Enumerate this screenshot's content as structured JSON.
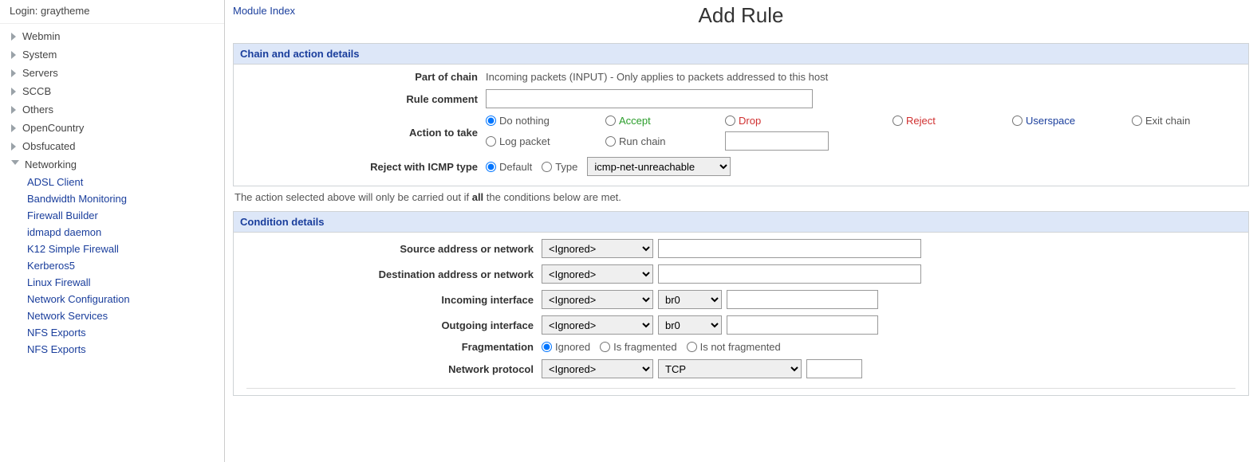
{
  "login": {
    "prefix": "Login:",
    "user": "graytheme"
  },
  "sidebar": {
    "items": [
      {
        "label": "Webmin"
      },
      {
        "label": "System"
      },
      {
        "label": "Servers"
      },
      {
        "label": "SCCB"
      },
      {
        "label": "Others"
      },
      {
        "label": "OpenCountry"
      },
      {
        "label": "Obsfucated"
      },
      {
        "label": "Networking",
        "expanded": true
      }
    ],
    "networking_children": [
      "ADSL Client",
      "Bandwidth Monitoring",
      "Firewall Builder",
      "idmapd daemon",
      "K12 Simple Firewall",
      "Kerberos5",
      "Linux Firewall",
      "Network Configuration",
      "Network Services",
      "NFS Exports",
      "NFS Exports"
    ]
  },
  "header": {
    "module_index": "Module Index",
    "title": "Add Rule"
  },
  "chain_panel": {
    "title": "Chain and action details",
    "part_of_chain_label": "Part of chain",
    "part_of_chain_value": "Incoming packets (INPUT) - Only applies to packets addressed to this host",
    "rule_comment_label": "Rule comment",
    "rule_comment_value": "",
    "action_label": "Action to take",
    "actions": {
      "do_nothing": "Do nothing",
      "accept": "Accept",
      "drop": "Drop",
      "reject": "Reject",
      "userspace": "Userspace",
      "exit_chain": "Exit chain",
      "log_packet": "Log packet",
      "run_chain": "Run chain"
    },
    "run_chain_value": "",
    "reject_icmp_label": "Reject with ICMP type",
    "reject_default": "Default",
    "reject_type": "Type",
    "reject_select": "icmp-net-unreachable"
  },
  "note": {
    "pre": "The action selected above will only be carried out if ",
    "bold": "all",
    "post": " the conditions below are met."
  },
  "cond_panel": {
    "title": "Condition details",
    "ignored": "<Ignored>",
    "src_label": "Source address or network",
    "src_value": "",
    "dst_label": "Destination address or network",
    "dst_value": "",
    "in_if_label": "Incoming interface",
    "out_if_label": "Outgoing interface",
    "iface_value": "br0",
    "iface_text": "",
    "frag_label": "Fragmentation",
    "frag_ignored": "Ignored",
    "frag_is": "Is fragmented",
    "frag_not": "Is not fragmented",
    "proto_label": "Network protocol",
    "proto_value": "TCP",
    "proto_text": ""
  }
}
